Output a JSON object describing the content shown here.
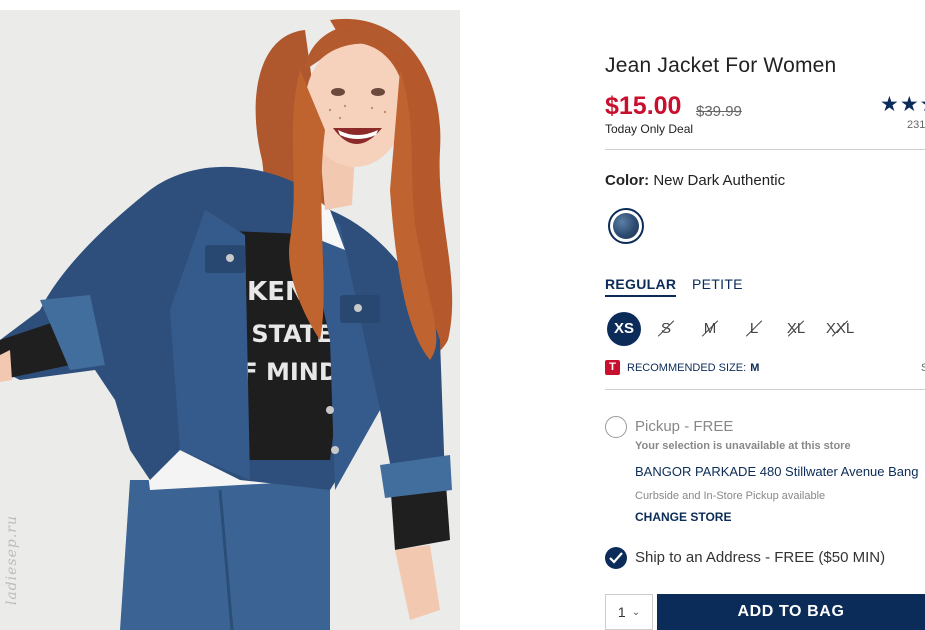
{
  "product": {
    "title": "Jean Jacket For Women",
    "price": "$15.00",
    "original_price": "$39.99",
    "deal_label": "Today Only Deal",
    "rating_stars": "★★★",
    "rating_filled": 3,
    "review_count": "231",
    "image_watermark": "ladiesep.ru"
  },
  "color": {
    "label": "Color:",
    "value": "New Dark Authentic",
    "swatch_color": "#2d4b70"
  },
  "fit_tabs": [
    {
      "label": "REGULAR",
      "active": true
    },
    {
      "label": "PETITE",
      "active": false
    }
  ],
  "sizes": [
    {
      "label": "XS",
      "selected": true,
      "available": true
    },
    {
      "label": "S",
      "selected": false,
      "available": false
    },
    {
      "label": "M",
      "selected": false,
      "available": false
    },
    {
      "label": "L",
      "selected": false,
      "available": false
    },
    {
      "label": "XL",
      "selected": false,
      "available": false
    },
    {
      "label": "XXL",
      "selected": false,
      "available": false
    }
  ],
  "recommended": {
    "icon_letter": "T",
    "label": "RECOMMENDED SIZE:",
    "value": "M",
    "right_text": "S"
  },
  "fulfillment": {
    "pickup_label": "Pickup - FREE",
    "unavailable_note": "Your selection is unavailable at this store",
    "store_address": "BANGOR PARKADE 480 Stillwater Avenue Bang",
    "curbside_note": "Curbside and In-Store Pickup available",
    "change_store": "CHANGE STORE",
    "ship_label": "Ship to an Address - FREE ($50 MIN)"
  },
  "cart": {
    "quantity": "1",
    "add_button": "ADD TO BAG"
  },
  "colors": {
    "navy": "#0b2c58",
    "sale_red": "#c8102e"
  }
}
